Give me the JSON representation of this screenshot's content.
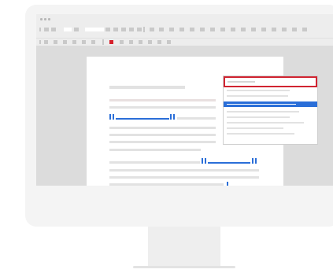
{
  "window": {
    "title": ""
  },
  "toolbar": {
    "row1_items": 24,
    "row2_items": 12,
    "highlight_color": "#d6202b"
  },
  "document": {
    "title": "",
    "lines": []
  },
  "autocomplete": {
    "selected_index": 3,
    "items": [
      "",
      "",
      "",
      "",
      "",
      "",
      "",
      ""
    ],
    "border_color": "#d12431",
    "highlight_color": "#2a6ed8"
  },
  "cursor": {
    "color": "#2a6ed8"
  }
}
